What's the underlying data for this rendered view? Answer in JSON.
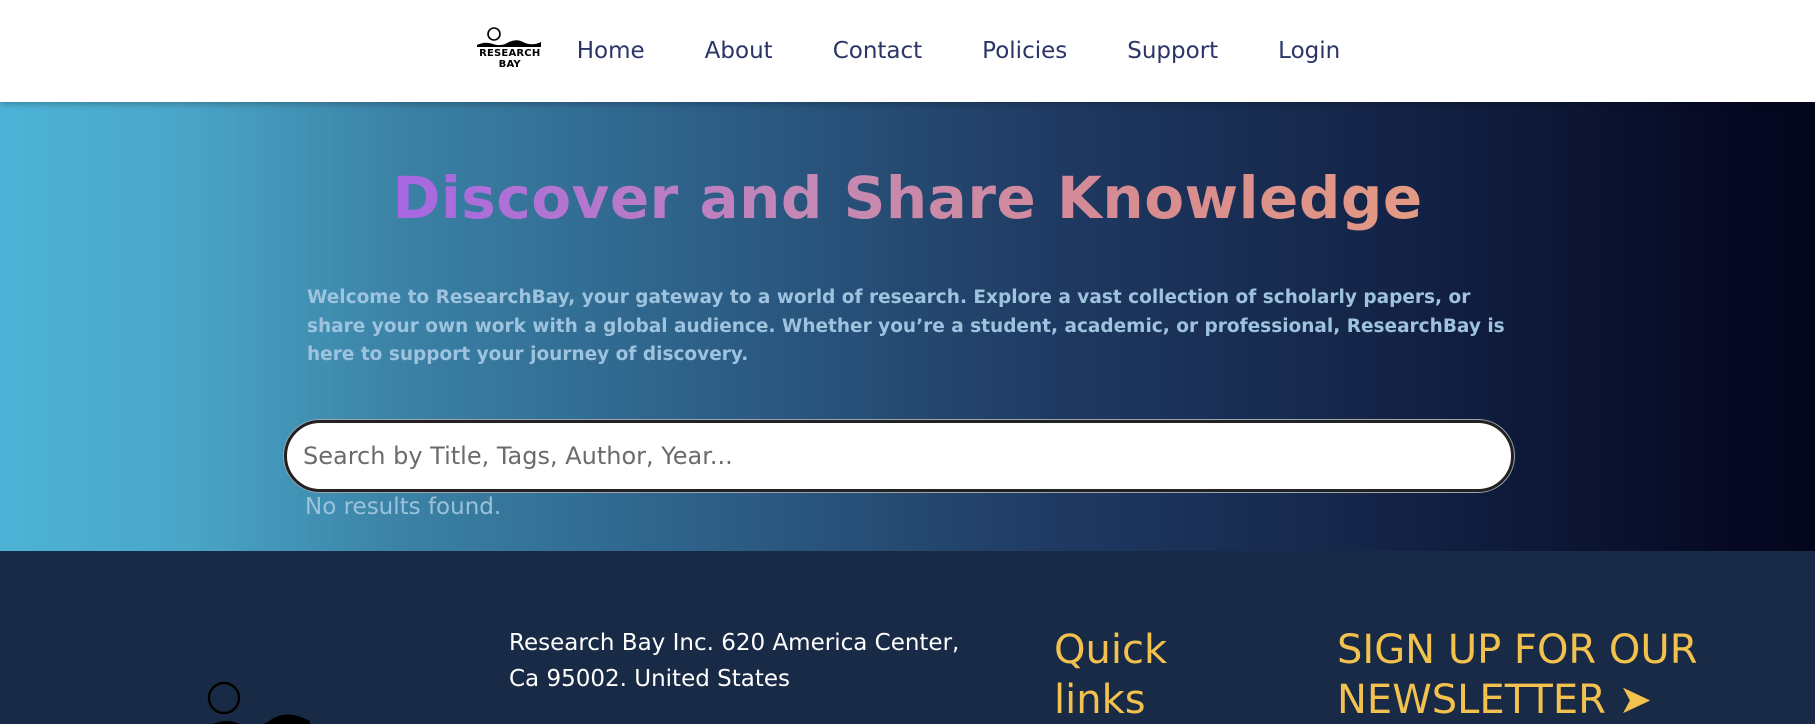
{
  "nav": {
    "logo_line1": "RESEARCH",
    "logo_line2": "BAY",
    "links": [
      "Home",
      "About",
      "Contact",
      "Policies",
      "Support",
      "Login"
    ]
  },
  "hero": {
    "title": "Discover and Share Knowledge",
    "description": "Welcome to ResearchBay, your gateway to a world of research. Explore a vast collection of scholarly papers, or share your own work with a global audience. Whether you’re a student, academic, or professional, ResearchBay is here to support your journey of discovery.",
    "search_placeholder": "Search by Title, Tags, Author, Year...",
    "search_value": "",
    "no_results": "No results found."
  },
  "footer": {
    "address": "Research Bay Inc. 620 America Center, Ca 95002. United States",
    "quick_links_title": "Quick links",
    "newsletter": "SIGN UP FOR OUR NEWSLETTER ➤"
  },
  "colors": {
    "nav_link": "#2b3466",
    "hero_left": "#4db3d6",
    "hero_right": "#04061c",
    "footer_bg": "#182a45",
    "accent_yellow": "#f2c14e"
  },
  "icons": {
    "logo": "research-bay-logo",
    "newsletter_arrow": "arrow-right-icon"
  }
}
